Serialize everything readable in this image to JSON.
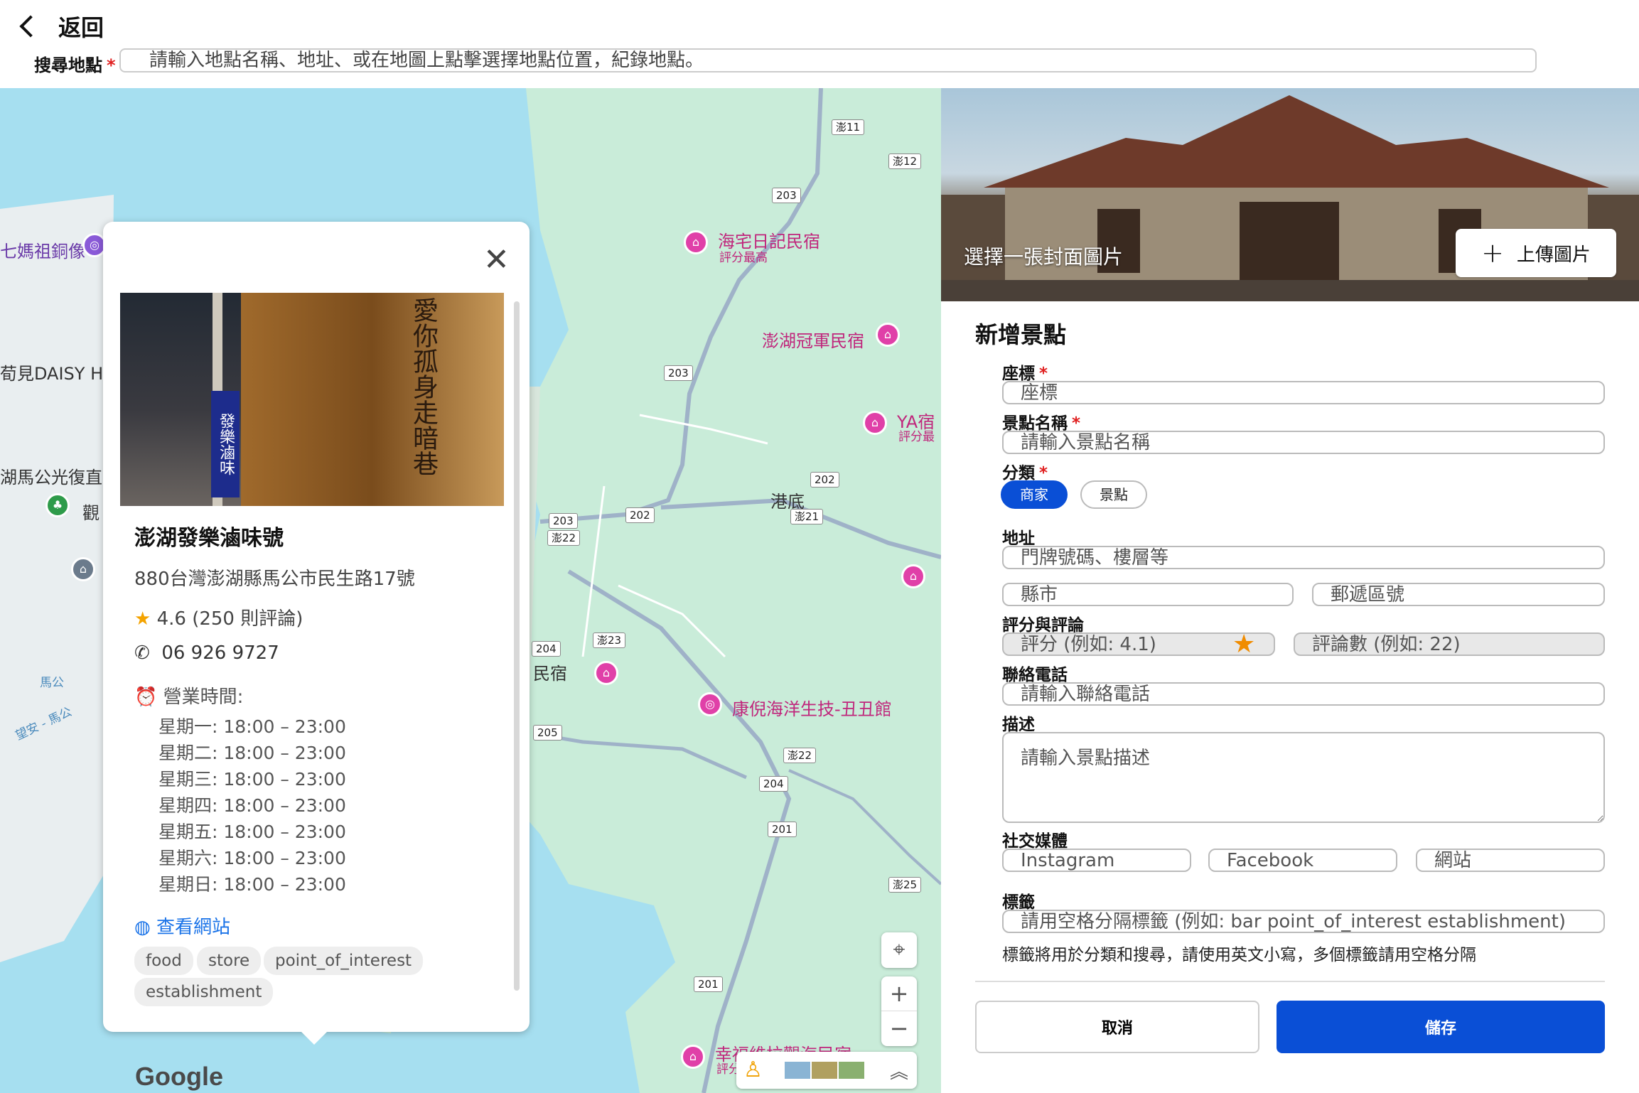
{
  "header": {
    "back_label": "返回",
    "search_label": "搜尋地點",
    "required_mark": "*",
    "search_placeholder": "請輸入地點名稱、地址、或在地圖上點擊選擇地點位置，紀錄地點。"
  },
  "map": {
    "labels": {
      "poi_1": "海宅日記民宿",
      "poi_1_sub": "評分最高",
      "poi_2": "澎湖冠軍民宿",
      "poi_3": "YA宿",
      "poi_3_sub": "評分最",
      "poi_4": "康倪海洋生技-丑丑館",
      "poi_5": "幸福維拉觀海民宿",
      "poi_5_sub": "評分",
      "place_1": "港底",
      "place_2": "民宿",
      "left_1": "七媽祖銅像",
      "left_2": "荀見DAISY HO",
      "left_3": "湖馬公光復直",
      "left_4": "觀",
      "road_1": "馬公",
      "road_2": "望安 - 馬公"
    },
    "shields": [
      "澎11",
      "澎12",
      "203",
      "203",
      "202",
      "澎21",
      "203",
      "202",
      "澎22",
      "204",
      "澎23",
      "205",
      "澎22",
      "204",
      "201",
      "澎25",
      "201"
    ],
    "logo": "Google",
    "zoom_in": "+",
    "zoom_out": "−"
  },
  "place_card": {
    "name": "澎湖發樂滷味號",
    "address": "880台灣澎湖縣馬公市民生路17號",
    "rating_text": "4.6 (250 則評論)",
    "phone": "06 926 9727",
    "hours_title": "營業時間:",
    "hours": [
      "星期一: 18:00 – 23:00",
      "星期二: 18:00 – 23:00",
      "星期三: 18:00 – 23:00",
      "星期四: 18:00 – 23:00",
      "星期五: 18:00 – 23:00",
      "星期六: 18:00 – 23:00",
      "星期日: 18:00 – 23:00"
    ],
    "website_label": "查看網站",
    "tags": [
      "food",
      "store",
      "point_of_interest",
      "establishment"
    ],
    "photo_sign_text": "發樂滷味",
    "photo_calligraphy": "愛你孤身走暗巷"
  },
  "form": {
    "cover_label": "選擇一張封面圖片",
    "upload_label": "上傳圖片",
    "title": "新增景點",
    "coord_label": "座標",
    "coord_placeholder": "座標",
    "name_label": "景點名稱",
    "name_placeholder": "請輸入景點名稱",
    "category_label": "分類",
    "category_options": [
      "商家",
      "景點"
    ],
    "category_selected": "商家",
    "address_label": "地址",
    "address_placeholder": "門牌號碼、樓層等",
    "city_placeholder": "縣市",
    "zip_placeholder": "郵遞區號",
    "rating_label": "評分與評論",
    "rating_placeholder": "評分 (例如: 4.1)",
    "reviews_placeholder": "評論數 (例如: 22)",
    "phone_label": "聯絡電話",
    "phone_placeholder": "請輸入聯絡電話",
    "desc_label": "描述",
    "desc_placeholder": "請輸入景點描述",
    "social_label": "社交媒體",
    "instagram_placeholder": "Instagram",
    "facebook_placeholder": "Facebook",
    "website_placeholder": "網站",
    "tags_label": "標籤",
    "tags_placeholder": "請用空格分隔標籤 (例如: bar point_of_interest establishment)",
    "tags_hint": "標籤將用於分類和搜尋，請使用英文小寫，多個標籤請用空格分隔",
    "cancel_label": "取消",
    "save_label": "儲存"
  },
  "colors": {
    "primary": "#0a4fd6",
    "poi_pink": "#e040a8",
    "star": "#f4a300",
    "water": "#a6dff0",
    "land": "#c9ecd9"
  }
}
